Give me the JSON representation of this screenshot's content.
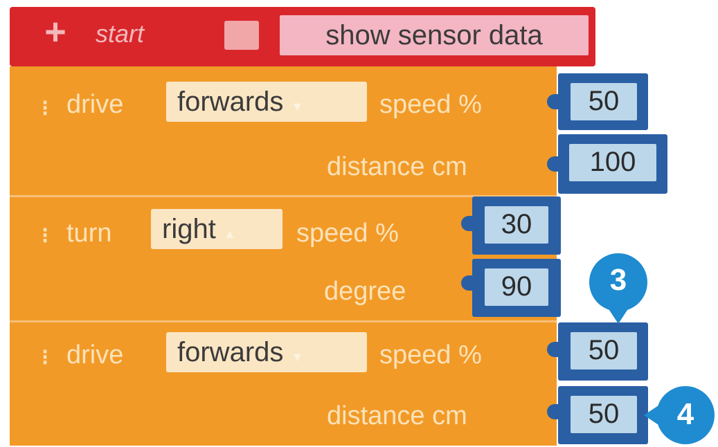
{
  "start": {
    "label": "start",
    "sensor_label": "show sensor data"
  },
  "blocks": [
    {
      "type": "drive",
      "keyword": "drive",
      "direction": "forwards",
      "param1": "speed %",
      "value1": "50",
      "param2": "distance cm",
      "value2": "100"
    },
    {
      "type": "turn",
      "keyword": "turn",
      "direction": "right",
      "param1": "speed %",
      "value1": "30",
      "param2": "degree",
      "value2": "90"
    },
    {
      "type": "drive",
      "keyword": "drive",
      "direction": "forwards",
      "param1": "speed %",
      "value1": "50",
      "param2": "distance cm",
      "value2": "50"
    }
  ],
  "callouts": [
    "3",
    "4"
  ],
  "colors": {
    "start": "#d9262b",
    "motion": "#f29a27",
    "value_slot": "#2a5fa4",
    "callout": "#1f8bd0"
  }
}
